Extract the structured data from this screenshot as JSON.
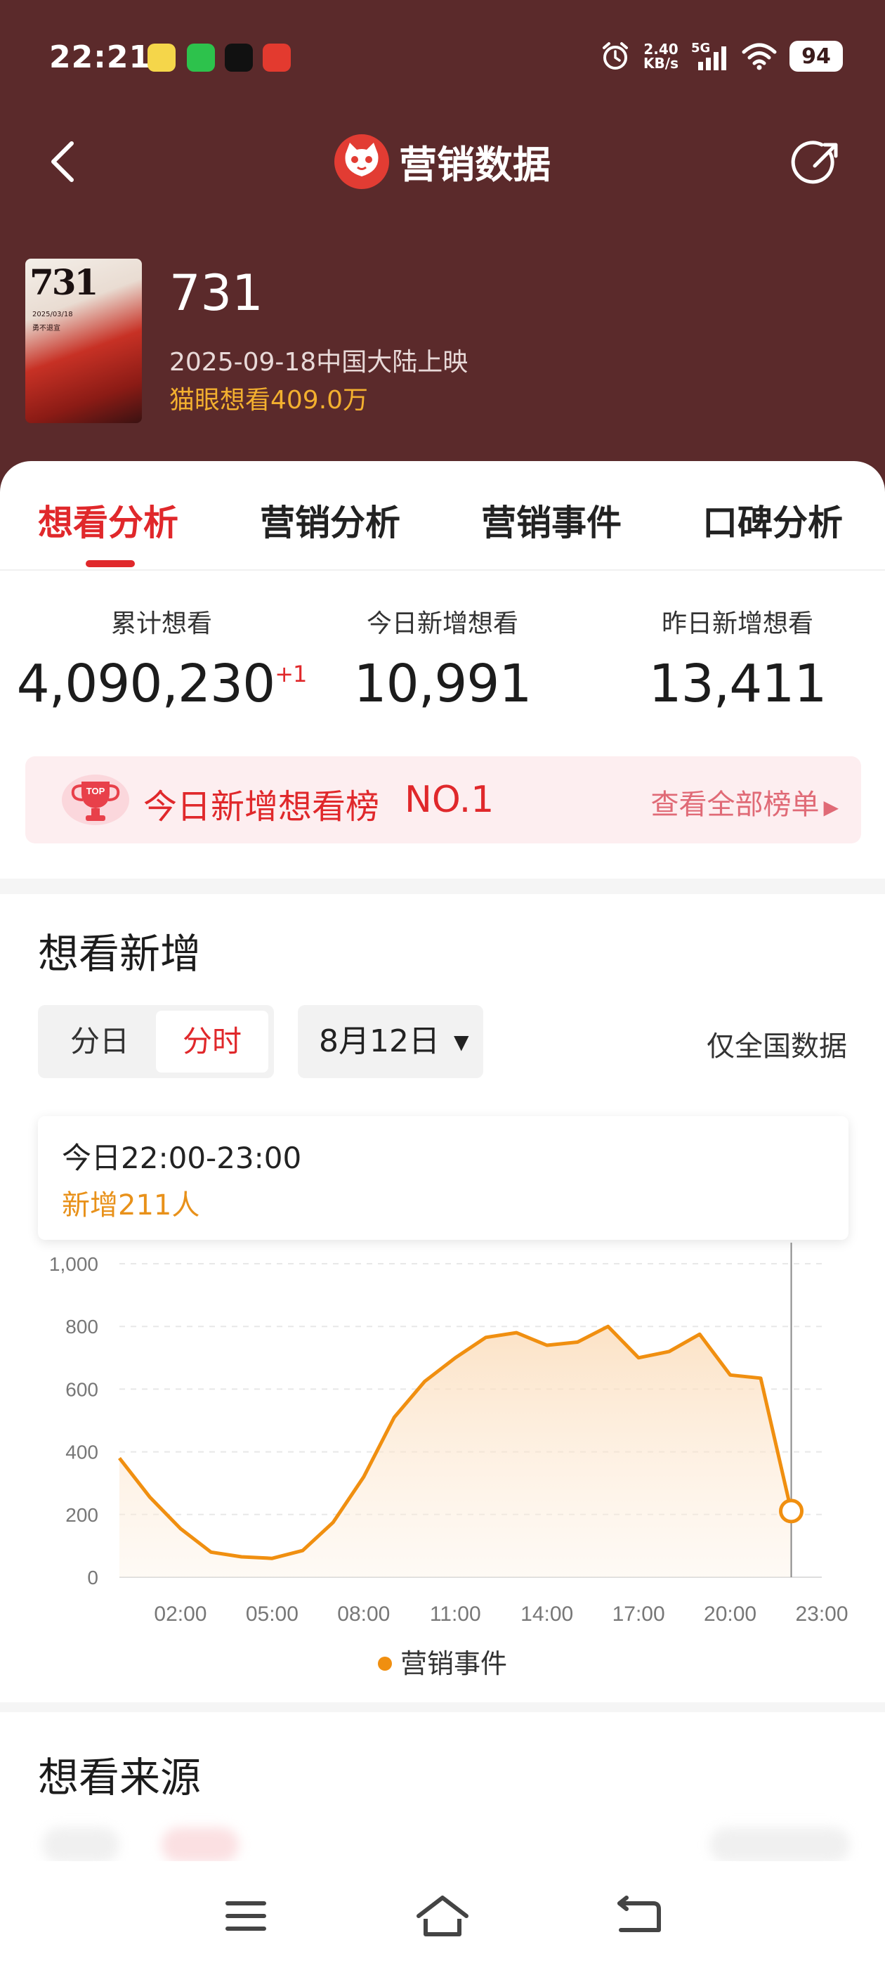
{
  "status_bar": {
    "time": "22:21",
    "net_speed_value": "2.40",
    "net_speed_unit": "KB/s",
    "signal_label": "5G",
    "battery": "94"
  },
  "nav": {
    "title": "营销数据"
  },
  "movie": {
    "title": "731",
    "release": "2025-09-18中国大陆上映",
    "want": "猫眼想看409.0万",
    "poster_title": "731",
    "poster_date": "2025/03/18",
    "poster_line2": "勇不退宣"
  },
  "tabs": [
    {
      "label": "想看分析",
      "active": true
    },
    {
      "label": "营销分析",
      "active": false
    },
    {
      "label": "营销事件",
      "active": false
    },
    {
      "label": "口碑分析",
      "active": false
    }
  ],
  "stats": [
    {
      "label": "累计想看",
      "value": "4,090,230",
      "delta": "+1"
    },
    {
      "label": "今日新增想看",
      "value": "10,991",
      "delta": ""
    },
    {
      "label": "昨日新增想看",
      "value": "13,411",
      "delta": ""
    }
  ],
  "rank": {
    "badge": "TOP",
    "title": "今日新增想看榜",
    "number": "NO.1",
    "link": "查看全部榜单"
  },
  "want_section": {
    "title": "想看新增",
    "seg_day": "分日",
    "seg_hour": "分时",
    "date": "8月12日",
    "national": "仅全国数据",
    "tooltip_time": "今日22:00-23:00",
    "tooltip_value": "新增211人",
    "legend": "营销事件"
  },
  "source_section": {
    "title": "想看来源"
  },
  "colors": {
    "header_bg": "#5b2a2b",
    "accent_red": "#e0282b",
    "line_orange": "#f08f10"
  },
  "chart_data": {
    "type": "area",
    "x": [
      "00:00",
      "01:00",
      "02:00",
      "03:00",
      "04:00",
      "05:00",
      "06:00",
      "07:00",
      "08:00",
      "09:00",
      "10:00",
      "11:00",
      "12:00",
      "13:00",
      "14:00",
      "15:00",
      "16:00",
      "17:00",
      "18:00",
      "19:00",
      "20:00",
      "21:00",
      "22:00"
    ],
    "x_ticks": [
      "02:00",
      "05:00",
      "08:00",
      "11:00",
      "14:00",
      "17:00",
      "20:00",
      "23:00"
    ],
    "y_ticks": [
      "1,000",
      "800",
      "600",
      "400",
      "200",
      "0"
    ],
    "ylim": [
      0,
      1000
    ],
    "series": [
      {
        "name": "营销事件",
        "values": [
          380,
          255,
          155,
          80,
          65,
          60,
          85,
          175,
          320,
          510,
          625,
          700,
          765,
          780,
          740,
          750,
          800,
          700,
          720,
          775,
          645,
          635,
          211
        ]
      }
    ],
    "highlight_index": 22,
    "grid": true,
    "legend": "bottom"
  }
}
